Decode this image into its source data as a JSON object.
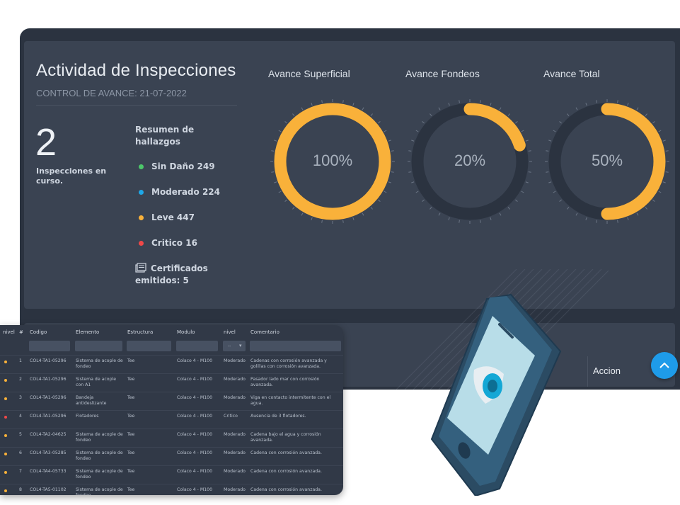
{
  "header": {
    "title": "Actividad de Inspecciones",
    "subtitle": "CONTROL DE AVANCE: 21-07-2022"
  },
  "inspections": {
    "count": "2",
    "label": "Inspecciones en curso."
  },
  "summary": {
    "title": "Resumen de hallazgos",
    "items": [
      {
        "label": "Sin Daño 249",
        "color": "#4cc76a"
      },
      {
        "label": "Moderado 224",
        "color": "#1ea8e8"
      },
      {
        "label": "Leve 447",
        "color": "#f9b13a"
      },
      {
        "label": "Critico 16",
        "color": "#f04848"
      }
    ],
    "certificates": "Certificados emitidos: 5",
    "certificates_icon": "certificate-icon"
  },
  "gauges": [
    {
      "title": "Avance Superficial",
      "label": "100%",
      "value": 1.0
    },
    {
      "title": "Avance Fondeos",
      "label": "20%",
      "value": 0.2
    },
    {
      "title": "Avance Total",
      "label": "50%",
      "value": 0.5
    }
  ],
  "colors": {
    "accent": "#f9b13a",
    "track": "#2b3340",
    "fab": "#1e9be9"
  },
  "actions": {
    "column_label": "Accion",
    "fab_icon": "chevron-up-icon"
  },
  "table": {
    "headers": [
      "nivel",
      "#",
      "Codigo",
      "Elemento",
      "Estructura",
      "Modulo",
      "nivel",
      "Comentario"
    ],
    "select_value": "--",
    "rows": [
      {
        "dot": "#f9b13a",
        "n": "1",
        "codigo": "COL4-TA1-05296",
        "elemento": "Sistema de acople de fondeo",
        "estructura": "Tee",
        "modulo": "Colaco 4 - M100",
        "nivel": "Moderado",
        "comentario": "Cadenas con corrosión avanzada y golillas con corrosión avanzada."
      },
      {
        "dot": "#f9b13a",
        "n": "2",
        "codigo": "COL4-TA1-05296",
        "elemento": "Sistema de acople con A1",
        "estructura": "Tee",
        "modulo": "Colaco 4 - M100",
        "nivel": "Moderado",
        "comentario": "Pasador lado mar con corrosión avanzada."
      },
      {
        "dot": "#f9b13a",
        "n": "3",
        "codigo": "COL4-TA1-05296",
        "elemento": "Bandeja antideslizante",
        "estructura": "Tee",
        "modulo": "Colaco 4 - M100",
        "nivel": "Moderado",
        "comentario": "Viga en contacto intermitente con el agua."
      },
      {
        "dot": "#f04848",
        "n": "4",
        "codigo": "COL4-TA1-05296",
        "elemento": "Flotadores",
        "estructura": "Tee",
        "modulo": "Colaco 4 - M100",
        "nivel": "Critico",
        "comentario": "Ausencia de 3 flotadores."
      },
      {
        "dot": "#f9b13a",
        "n": "5",
        "codigo": "COL4-TA2-04625",
        "elemento": "Sistema de acople de fondeo",
        "estructura": "Tee",
        "modulo": "Colaco 4 - M100",
        "nivel": "Moderado",
        "comentario": "Cadena bajo el agua y corrosión avanzada."
      },
      {
        "dot": "#f9b13a",
        "n": "6",
        "codigo": "COL4-TA3-05285",
        "elemento": "Sistema de acople de fondeo",
        "estructura": "Tee",
        "modulo": "Colaco 4 - M100",
        "nivel": "Moderado",
        "comentario": "Cadena con corrosión avanzada."
      },
      {
        "dot": "#f9b13a",
        "n": "7",
        "codigo": "COL4-TA4-05733",
        "elemento": "Sistema de acople de fondeo",
        "estructura": "Tee",
        "modulo": "Colaco 4 - M100",
        "nivel": "Moderado",
        "comentario": "Cadena con corrosión avanzada."
      },
      {
        "dot": "#f9b13a",
        "n": "8",
        "codigo": "COL4-TA5-01102",
        "elemento": "Sistema de acople de fondeo",
        "estructura": "Tee",
        "modulo": "Colaco 4 - M100",
        "nivel": "Moderado",
        "comentario": "Cadena con corrosión avanzada."
      }
    ]
  },
  "illustration": {
    "icon": "eye-icon"
  }
}
